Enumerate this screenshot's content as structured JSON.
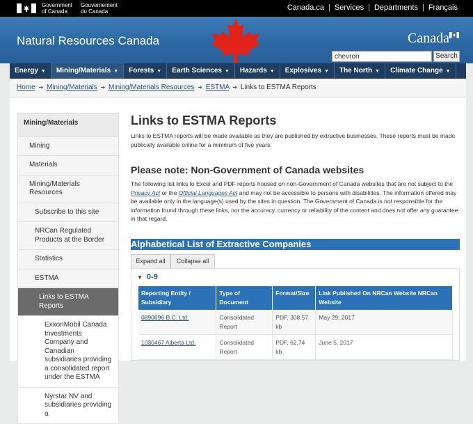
{
  "fip": {
    "gov_en_line1": "Government",
    "gov_en_line2": "of Canada",
    "gov_fr_line1": "Gouvernement",
    "gov_fr_line2": "du Canada",
    "links": [
      "Canada.ca",
      "Services",
      "Departments",
      "Français"
    ]
  },
  "banner": {
    "site_title": "Natural Resources Canada",
    "wordmark": "Canada"
  },
  "search": {
    "value": "chevron",
    "button_label": "Search"
  },
  "menu": {
    "items": [
      {
        "label": "Energy"
      },
      {
        "label": "Mining/Materials"
      },
      {
        "label": "Forests"
      },
      {
        "label": "Earth Sciences"
      },
      {
        "label": "Hazards"
      },
      {
        "label": "Explosives"
      },
      {
        "label": "The North"
      },
      {
        "label": "Climate Change"
      }
    ]
  },
  "breadcrumb": {
    "items": [
      "Home",
      "Mining/Materials",
      "Mining/Materials Resources",
      "ESTMA",
      "Links to ESTMA Reports"
    ]
  },
  "leftnav": {
    "items": [
      {
        "label": "Mining/Materials"
      },
      {
        "label": "Mining"
      },
      {
        "label": "Materials"
      },
      {
        "label": "Mining/Materials Resources"
      },
      {
        "label": "Subscribe to this site"
      },
      {
        "label": "NRCan Regulated Products at the Border"
      },
      {
        "label": "Statistics"
      },
      {
        "label": "ESTMA"
      },
      {
        "label": "Links to ESTMA Reports"
      },
      {
        "label": "ExxonMobil Canada Investments Company and Canadian subsidiaries providing a consolidated report under the ESTMA"
      },
      {
        "label": "Nyrstar NV and subsidiaries providing a"
      }
    ]
  },
  "main": {
    "title": "Links to ESTMA Reports",
    "intro": "Links to ESTMA reports will be made available as they are published by extractive businesses. These reports must be made publically available online for a minimum of five years.",
    "note_heading": "Please note: Non-Government of Canada websites",
    "note_part1": "The following list links to Excel and PDF reports housed on non-Government of Canada websites that are not subject to the ",
    "note_link1": "Privacy Act",
    "note_part2": " or the ",
    "note_link2": "Official Languages Act",
    "note_part3": " and may not be accessible to persons with disabilities. The information offered may be available only in the language(s) used by the sites in question. The Government of Canada is not responsible for the information found through these links, nor the accuracy, currency or reliability of the content and does not offer any guarantee in that regard.",
    "list_heading": "Alphabetical List of Extractive Companies",
    "expand_all": "Expand all",
    "collapse_all": "Collapse all",
    "section_title": "0-9"
  },
  "table": {
    "headers": [
      "Reporting Entity / Subsidiary",
      "Type of Document",
      "Format/Size",
      "Link Published On NRCan Website NRCan Website"
    ],
    "rows": [
      {
        "entity": "0890696 B.C. Ltd.",
        "type": "Consolidated Report",
        "format": "PDF, 308.57 kb",
        "date": "May 29, 2017"
      },
      {
        "entity": "1030467 Alberta Ltd.",
        "type": "Consolidated Report",
        "format": "PDF, 62.74 kb",
        "date": "June 5, 2017"
      }
    ]
  },
  "colors": {
    "fip_bg": "#000000",
    "banner_blue": "#2d68a4",
    "menu_navy": "#1f3d62",
    "accent_blue": "#2b72b8",
    "leaf_red": "#e1231a"
  }
}
